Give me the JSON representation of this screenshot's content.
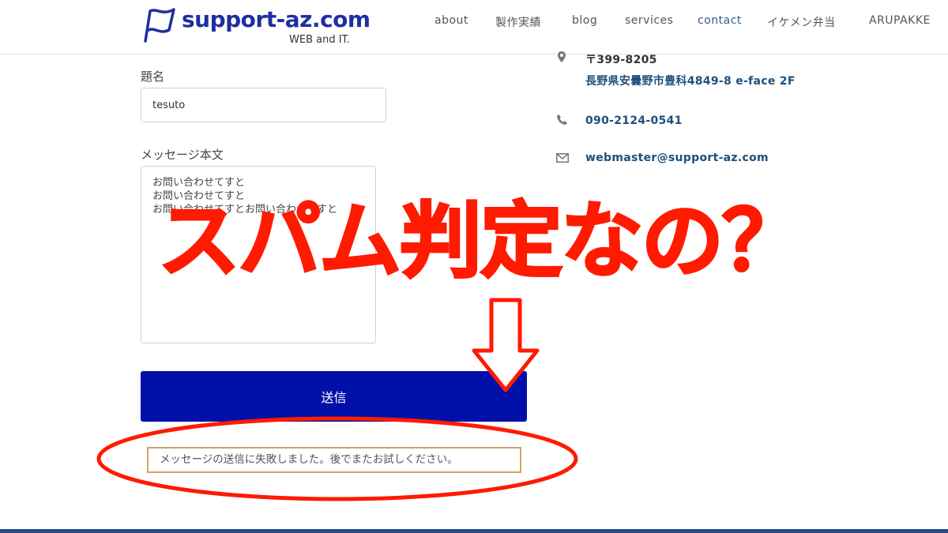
{
  "header": {
    "logo_text": "support-az.com",
    "logo_sub": "WEB and IT.",
    "nav": [
      {
        "label": "about"
      },
      {
        "label": "製作実績"
      },
      {
        "label": "blog"
      },
      {
        "label": "services"
      },
      {
        "label": "contact",
        "active": true
      },
      {
        "label": "イケメン弁当"
      },
      {
        "label": "ARUPAKKE"
      }
    ]
  },
  "form": {
    "subject_label": "題名",
    "subject_value": "tesuto",
    "message_label": "メッセージ本文",
    "message_value": "お問い合わせてすと\nお問い合わせてすと\nお問い合わせてすとお問い合わせてすと",
    "send_label": "送信",
    "error_message": "メッセージの送信に失敗しました。後でまたお試しください。"
  },
  "contact_info": {
    "postal": "〒399-8205",
    "address": "長野県安曇野市豊科4849-8 e-face 2F",
    "phone": "090-2124-0541",
    "email": "webmaster@support-az.com"
  },
  "annotation": {
    "title": "スパム判定なの？",
    "color": "#ff1a00"
  },
  "colors": {
    "brand": "#1f2fa0",
    "send_button": "#0010a8",
    "link": "#1f4f7a",
    "error_border": "#d5a066"
  }
}
